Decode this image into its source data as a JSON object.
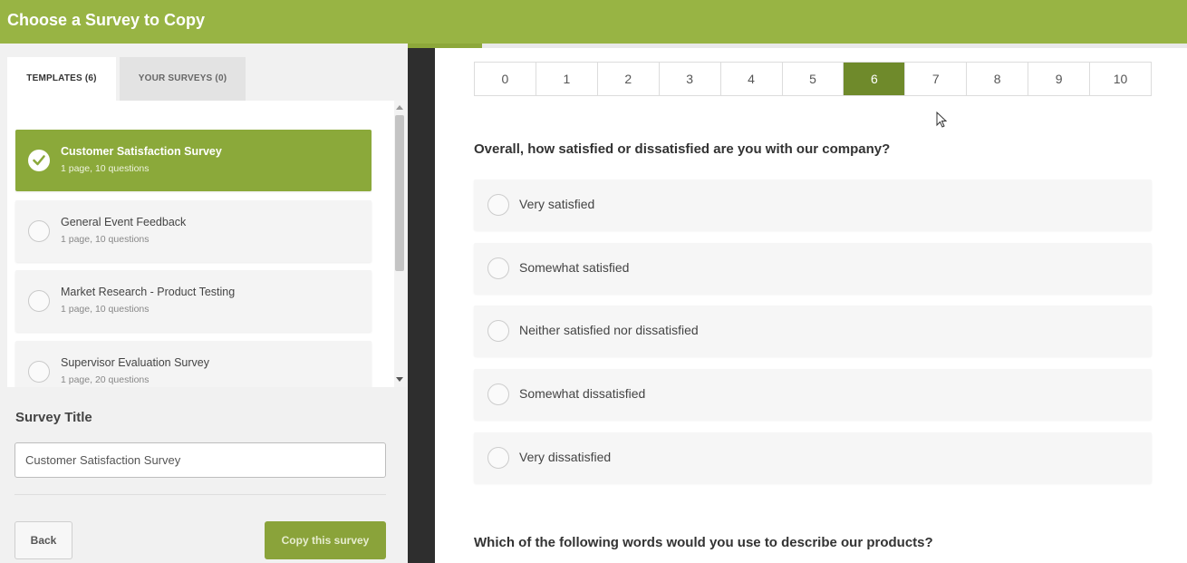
{
  "header": {
    "title": "Choose a Survey to Copy"
  },
  "tabs": [
    {
      "label": "TEMPLATES  (6)",
      "active": true
    },
    {
      "label": "YOUR SURVEYS  (0)",
      "active": false
    }
  ],
  "templates": [
    {
      "name": "Customer Satisfaction Survey",
      "meta": "1 page, 10 questions",
      "selected": true
    },
    {
      "name": "General Event Feedback",
      "meta": "1 page, 10 questions",
      "selected": false
    },
    {
      "name": "Market Research - Product Testing",
      "meta": "1 page, 10 questions",
      "selected": false
    },
    {
      "name": "Supervisor Evaluation Survey",
      "meta": "1 page, 20 questions",
      "selected": false
    }
  ],
  "survey_title": {
    "label": "Survey Title",
    "value": "Customer Satisfaction Survey"
  },
  "actions": {
    "back": "Back",
    "copy": "Copy this survey"
  },
  "preview": {
    "scale": [
      "0",
      "1",
      "2",
      "3",
      "4",
      "5",
      "6",
      "7",
      "8",
      "9",
      "10"
    ],
    "scale_selected": "6",
    "q1": "Overall, how satisfied or dissatisfied are you with our company?",
    "q1_options": [
      "Very satisfied",
      "Somewhat satisfied",
      "Neither satisfied nor dissatisfied",
      "Somewhat dissatisfied",
      "Very dissatisfied"
    ],
    "q2": "Which of the following words would you use to describe our products?"
  },
  "colors": {
    "brand": "#98b444",
    "selected": "#8ba93a",
    "scale_selected": "#6f8a2b"
  }
}
